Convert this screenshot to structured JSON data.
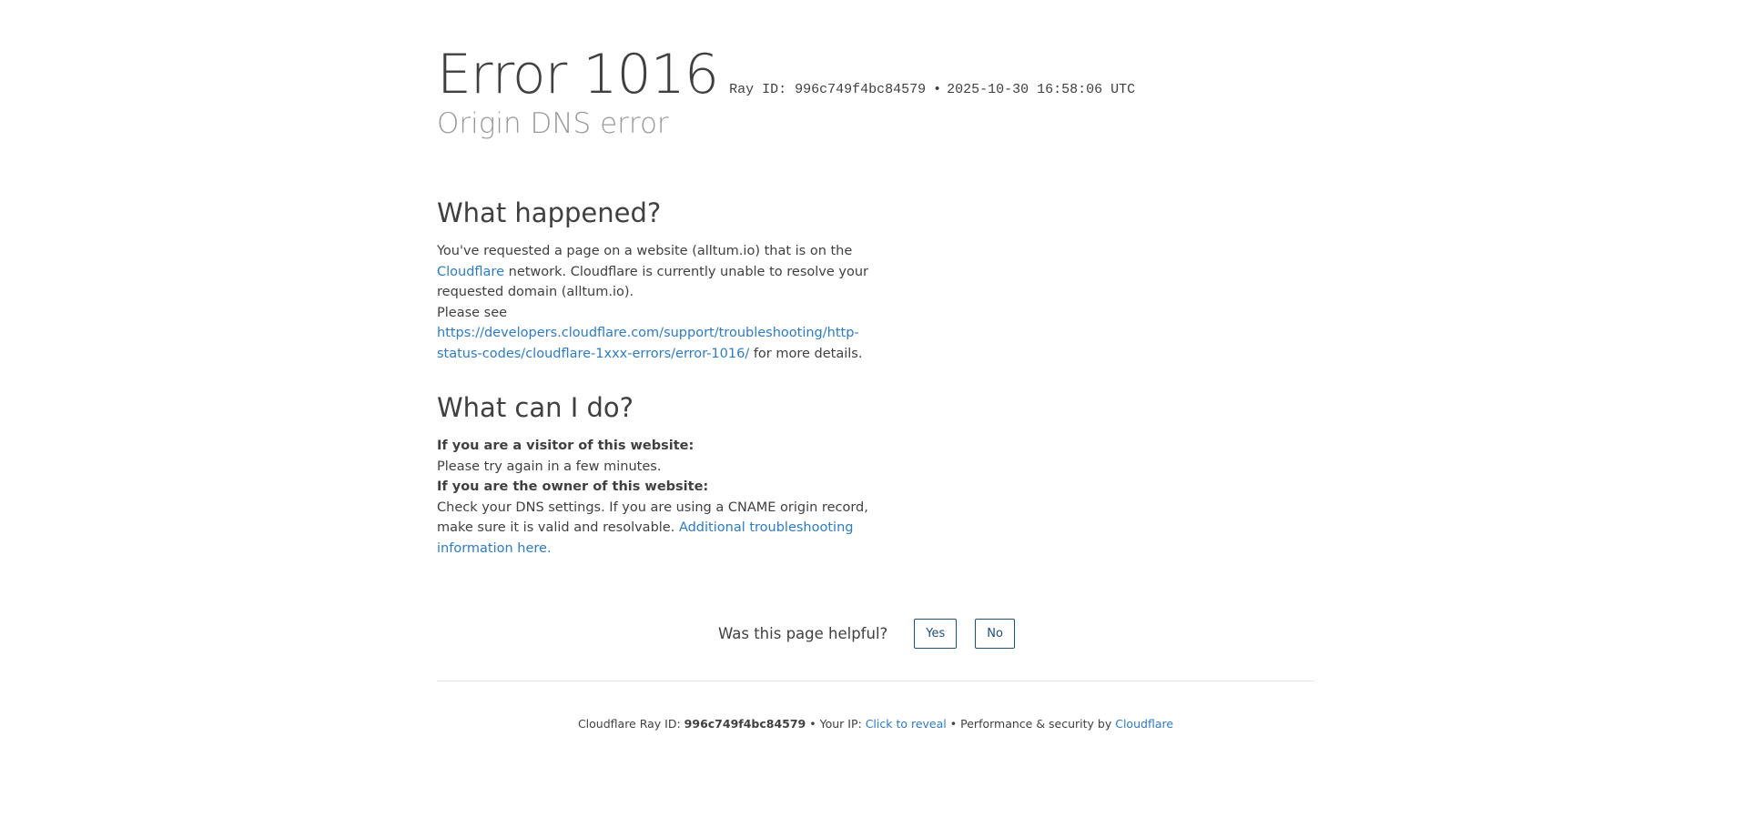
{
  "header": {
    "error_title": "Error 1016",
    "ray_id_text": "Ray ID: 996c749f4bc84579",
    "separator": "•",
    "timestamp": "2025-10-30 16:58:06 UTC",
    "subtitle": "Origin DNS error"
  },
  "what_happened": {
    "heading": "What happened?",
    "text_1": "You've requested a page on a website (alltum.io) that is on the ",
    "cloudflare_link": "Cloudflare",
    "text_2": " network. Cloudflare is currently unable to resolve your requested domain (alltum.io).",
    "please_see": "Please see ",
    "docs_link": "https://developers.cloudflare.com/support/troubleshooting/http-status-codes/cloudflare-1xxx-errors/error-1016/",
    "for_more": " for more details."
  },
  "what_can_i_do": {
    "heading": "What can I do?",
    "visitor_label": "If you are a visitor of this website:",
    "visitor_text": "Please try again in a few minutes.",
    "owner_label": "If you are the owner of this website:",
    "owner_text": "Check your DNS settings. If you are using a CNAME origin record, make sure it is valid and resolvable. ",
    "troubleshoot_link": "Additional troubleshooting information here."
  },
  "feedback": {
    "question": "Was this page helpful?",
    "yes_label": "Yes",
    "no_label": "No"
  },
  "footer": {
    "ray_label": "Cloudflare Ray ID: ",
    "ray_id": "996c749f4bc84579",
    "sep": "•",
    "ip_label": "Your IP: ",
    "ip_link": "Click to reveal",
    "perf_label": "Performance & security by ",
    "cf_link": "Cloudflare"
  },
  "colors": {
    "link": "#2f7bbf",
    "text": "#404040",
    "subtitle": "#999999",
    "button_border": "#1f4e79"
  }
}
